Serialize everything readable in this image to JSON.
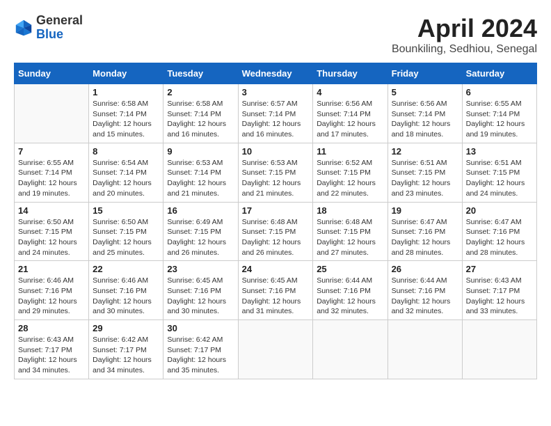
{
  "header": {
    "logo_general": "General",
    "logo_blue": "Blue",
    "month_title": "April 2024",
    "location": "Bounkiling, Sedhiou, Senegal"
  },
  "weekdays": [
    "Sunday",
    "Monday",
    "Tuesday",
    "Wednesday",
    "Thursday",
    "Friday",
    "Saturday"
  ],
  "weeks": [
    [
      {
        "num": "",
        "info": ""
      },
      {
        "num": "1",
        "info": "Sunrise: 6:58 AM\nSunset: 7:14 PM\nDaylight: 12 hours\nand 15 minutes."
      },
      {
        "num": "2",
        "info": "Sunrise: 6:58 AM\nSunset: 7:14 PM\nDaylight: 12 hours\nand 16 minutes."
      },
      {
        "num": "3",
        "info": "Sunrise: 6:57 AM\nSunset: 7:14 PM\nDaylight: 12 hours\nand 16 minutes."
      },
      {
        "num": "4",
        "info": "Sunrise: 6:56 AM\nSunset: 7:14 PM\nDaylight: 12 hours\nand 17 minutes."
      },
      {
        "num": "5",
        "info": "Sunrise: 6:56 AM\nSunset: 7:14 PM\nDaylight: 12 hours\nand 18 minutes."
      },
      {
        "num": "6",
        "info": "Sunrise: 6:55 AM\nSunset: 7:14 PM\nDaylight: 12 hours\nand 19 minutes."
      }
    ],
    [
      {
        "num": "7",
        "info": "Sunrise: 6:55 AM\nSunset: 7:14 PM\nDaylight: 12 hours\nand 19 minutes."
      },
      {
        "num": "8",
        "info": "Sunrise: 6:54 AM\nSunset: 7:14 PM\nDaylight: 12 hours\nand 20 minutes."
      },
      {
        "num": "9",
        "info": "Sunrise: 6:53 AM\nSunset: 7:14 PM\nDaylight: 12 hours\nand 21 minutes."
      },
      {
        "num": "10",
        "info": "Sunrise: 6:53 AM\nSunset: 7:15 PM\nDaylight: 12 hours\nand 21 minutes."
      },
      {
        "num": "11",
        "info": "Sunrise: 6:52 AM\nSunset: 7:15 PM\nDaylight: 12 hours\nand 22 minutes."
      },
      {
        "num": "12",
        "info": "Sunrise: 6:51 AM\nSunset: 7:15 PM\nDaylight: 12 hours\nand 23 minutes."
      },
      {
        "num": "13",
        "info": "Sunrise: 6:51 AM\nSunset: 7:15 PM\nDaylight: 12 hours\nand 24 minutes."
      }
    ],
    [
      {
        "num": "14",
        "info": "Sunrise: 6:50 AM\nSunset: 7:15 PM\nDaylight: 12 hours\nand 24 minutes."
      },
      {
        "num": "15",
        "info": "Sunrise: 6:50 AM\nSunset: 7:15 PM\nDaylight: 12 hours\nand 25 minutes."
      },
      {
        "num": "16",
        "info": "Sunrise: 6:49 AM\nSunset: 7:15 PM\nDaylight: 12 hours\nand 26 minutes."
      },
      {
        "num": "17",
        "info": "Sunrise: 6:48 AM\nSunset: 7:15 PM\nDaylight: 12 hours\nand 26 minutes."
      },
      {
        "num": "18",
        "info": "Sunrise: 6:48 AM\nSunset: 7:15 PM\nDaylight: 12 hours\nand 27 minutes."
      },
      {
        "num": "19",
        "info": "Sunrise: 6:47 AM\nSunset: 7:16 PM\nDaylight: 12 hours\nand 28 minutes."
      },
      {
        "num": "20",
        "info": "Sunrise: 6:47 AM\nSunset: 7:16 PM\nDaylight: 12 hours\nand 28 minutes."
      }
    ],
    [
      {
        "num": "21",
        "info": "Sunrise: 6:46 AM\nSunset: 7:16 PM\nDaylight: 12 hours\nand 29 minutes."
      },
      {
        "num": "22",
        "info": "Sunrise: 6:46 AM\nSunset: 7:16 PM\nDaylight: 12 hours\nand 30 minutes."
      },
      {
        "num": "23",
        "info": "Sunrise: 6:45 AM\nSunset: 7:16 PM\nDaylight: 12 hours\nand 30 minutes."
      },
      {
        "num": "24",
        "info": "Sunrise: 6:45 AM\nSunset: 7:16 PM\nDaylight: 12 hours\nand 31 minutes."
      },
      {
        "num": "25",
        "info": "Sunrise: 6:44 AM\nSunset: 7:16 PM\nDaylight: 12 hours\nand 32 minutes."
      },
      {
        "num": "26",
        "info": "Sunrise: 6:44 AM\nSunset: 7:16 PM\nDaylight: 12 hours\nand 32 minutes."
      },
      {
        "num": "27",
        "info": "Sunrise: 6:43 AM\nSunset: 7:17 PM\nDaylight: 12 hours\nand 33 minutes."
      }
    ],
    [
      {
        "num": "28",
        "info": "Sunrise: 6:43 AM\nSunset: 7:17 PM\nDaylight: 12 hours\nand 34 minutes."
      },
      {
        "num": "29",
        "info": "Sunrise: 6:42 AM\nSunset: 7:17 PM\nDaylight: 12 hours\nand 34 minutes."
      },
      {
        "num": "30",
        "info": "Sunrise: 6:42 AM\nSunset: 7:17 PM\nDaylight: 12 hours\nand 35 minutes."
      },
      {
        "num": "",
        "info": ""
      },
      {
        "num": "",
        "info": ""
      },
      {
        "num": "",
        "info": ""
      },
      {
        "num": "",
        "info": ""
      }
    ]
  ]
}
